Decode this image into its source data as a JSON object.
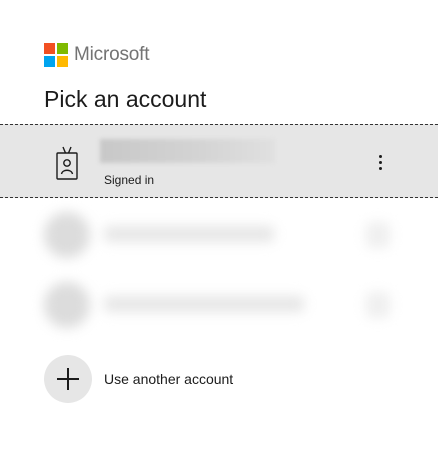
{
  "brand": {
    "name": "Microsoft",
    "logo_colors": [
      "#f25022",
      "#7fba00",
      "#00a4ef",
      "#ffb900"
    ]
  },
  "page": {
    "title": "Pick an account"
  },
  "selected_account": {
    "icon": "badge-icon",
    "email": "",
    "status": "Signed in",
    "more_icon": "more-vertical-icon"
  },
  "other_accounts": [
    {
      "blurred": true
    },
    {
      "blurred": true
    }
  ],
  "add_account": {
    "icon": "plus-icon",
    "label": "Use another account"
  }
}
